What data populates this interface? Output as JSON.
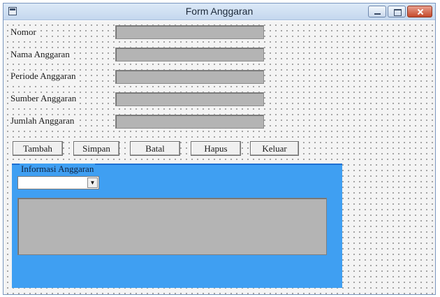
{
  "window": {
    "title": "Form Anggaran"
  },
  "form": {
    "fields": [
      {
        "label": "Nomor",
        "value": ""
      },
      {
        "label": "Nama Anggaran",
        "value": ""
      },
      {
        "label": "Periode Anggaran",
        "value": ""
      },
      {
        "label": "Sumber Anggaran",
        "value": ""
      },
      {
        "label": "Jumlah Anggaran",
        "value": ""
      }
    ],
    "buttons": {
      "tambah": "Tambah",
      "simpan": "Simpan",
      "batal": "Batal",
      "hapus": "Hapus",
      "keluar": "Keluar"
    }
  },
  "info_frame": {
    "caption": "Informasi Anggaran",
    "combo_value": "",
    "combo_arrow": "▼",
    "list_items": []
  },
  "colors": {
    "frame_background": "#3f9ff2",
    "field_background": "#b4b4b4",
    "form_background": "#f4f4f4"
  },
  "icons": {
    "app": "app-icon",
    "minimize": "minimize-icon",
    "maximize": "maximize-icon",
    "close": "close-icon",
    "dropdown": "chevron-down-icon"
  }
}
